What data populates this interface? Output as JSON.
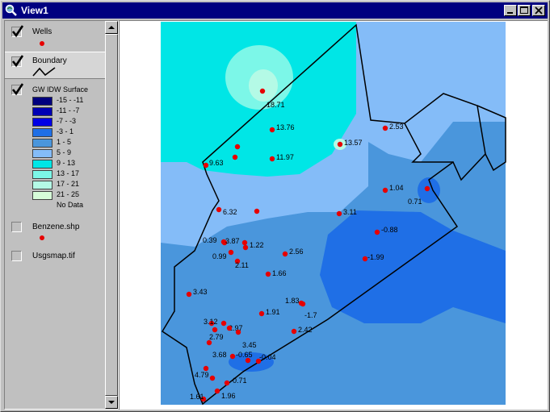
{
  "window": {
    "title": "View1"
  },
  "toc": {
    "layers": [
      {
        "name": "Wells",
        "checked": true,
        "symbol": "red-dot"
      },
      {
        "name": "Boundary",
        "checked": true,
        "symbol": "line"
      },
      {
        "name": "GW IDW Surface",
        "checked": true,
        "symbol": "classes"
      },
      {
        "name": "Benzene.shp",
        "checked": false,
        "symbol": "red-dot"
      },
      {
        "name": "Usgsmap.tif",
        "checked": false,
        "symbol": "none"
      }
    ],
    "legend": [
      {
        "label": "-15 - -11",
        "color": "#00007e"
      },
      {
        "label": "-11 - -7",
        "color": "#0000b4"
      },
      {
        "label": "-7 - -3",
        "color": "#0000e6"
      },
      {
        "label": "-3 - 1",
        "color": "#1f6fe6"
      },
      {
        "label": "1 - 5",
        "color": "#4a96dc"
      },
      {
        "label": "5 - 9",
        "color": "#84bcf8"
      },
      {
        "label": "9 - 13",
        "color": "#00e6e6"
      },
      {
        "label": "13 - 17",
        "color": "#7cf7e8"
      },
      {
        "label": "17 - 21",
        "color": "#b4fae6"
      },
      {
        "label": "21 - 25",
        "color": "#d6fcd8"
      },
      {
        "label": "No Data",
        "color": ""
      }
    ]
  },
  "map": {
    "wells": [
      {
        "label": "18.71"
      },
      {
        "label": "13.76"
      },
      {
        "label": "13.57"
      },
      {
        "label": "11.97"
      },
      {
        "label": "2.53"
      },
      {
        "label": "9.63"
      },
      {
        "label": ""
      },
      {
        "label": ""
      },
      {
        "label": "1.04"
      },
      {
        "label": "0.71"
      },
      {
        "label": "6.32"
      },
      {
        "label": ""
      },
      {
        "label": "3.11"
      },
      {
        "label": "-0.88"
      },
      {
        "label": "0.39"
      },
      {
        "label": "3.87"
      },
      {
        "label": "1.22"
      },
      {
        "label": "0.99"
      },
      {
        "label": ""
      },
      {
        "label": "2.11"
      },
      {
        "label": "2.56"
      },
      {
        "label": "-1.99"
      },
      {
        "label": "1.66"
      },
      {
        "label": "3.43"
      },
      {
        "label": "1.83"
      },
      {
        "label": "-1.7"
      },
      {
        "label": "1.91"
      },
      {
        "label": "3.12"
      },
      {
        "label": "2.97"
      },
      {
        "label": "2.79"
      },
      {
        "label": ""
      },
      {
        "label": "3.45"
      },
      {
        "label": "2.42"
      },
      {
        "label": "3.68"
      },
      {
        "label": "-0.65"
      },
      {
        "label": "-0.04"
      },
      {
        "label": ""
      },
      {
        "label": "4.79"
      },
      {
        "label": "0.71"
      },
      {
        "label": ""
      },
      {
        "label": "1.61"
      },
      {
        "label": "1.96"
      }
    ]
  }
}
